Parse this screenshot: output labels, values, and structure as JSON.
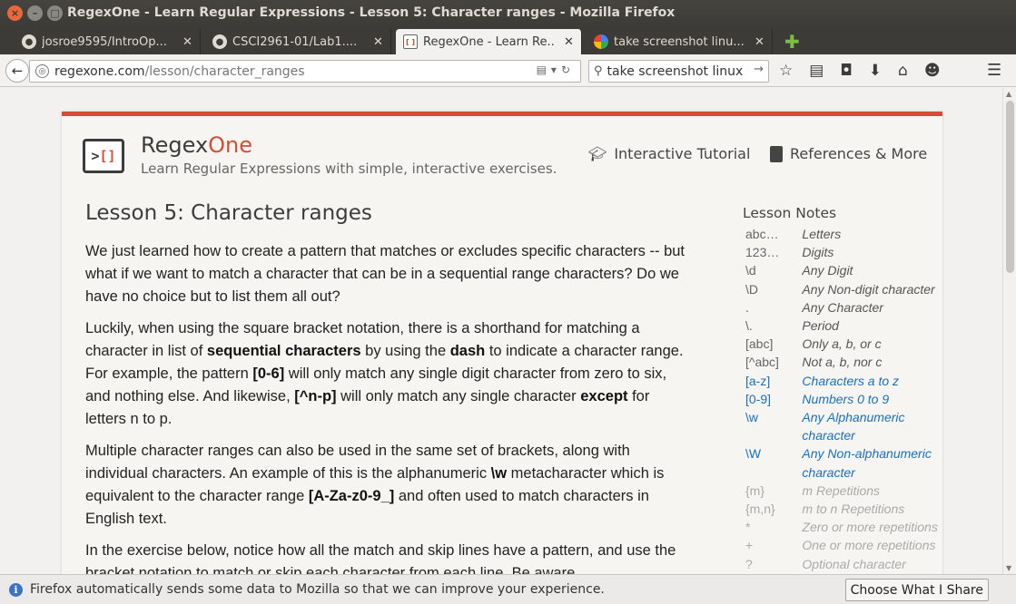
{
  "window": {
    "title": "RegexOne - Learn Regular Expressions - Lesson 5: Character ranges - Mozilla Firefox"
  },
  "tabs": [
    {
      "title": "josroe9595/IntroOp...",
      "icon": "github-icon"
    },
    {
      "title": "CSCI2961-01/Lab1....",
      "icon": "github-icon"
    },
    {
      "title": "RegexOne - Learn Re...",
      "icon": "regexone-icon"
    },
    {
      "title": "take screenshot linu...",
      "icon": "google-icon"
    }
  ],
  "nav": {
    "url_host": "regexone.com",
    "url_path": "/lesson/character_ranges",
    "search_value": "take screenshot linux"
  },
  "site": {
    "brand_main": "Regex",
    "brand_accent": "One",
    "tagline": "Learn Regular Expressions with simple, interactive exercises.",
    "nav_tutorial": "Interactive Tutorial",
    "nav_refs": "References & More",
    "accent_color": "#d64d34"
  },
  "lesson": {
    "title": "Lesson 5: Character ranges",
    "p1": "We just learned how to create a pattern that matches or excludes specific characters -- but what if we want to match a character that can be in a sequential range characters? Do we have no choice but to list them all out?",
    "p2": {
      "a": "Luckily, when using the square bracket notation, there is a shorthand for matching a character in list of ",
      "b": "sequential characters",
      "c": " by using the ",
      "d": "dash",
      "e": " to indicate a character range. For example, the pattern ",
      "f": "[0-6]",
      "g": " will only match any single digit character from zero to six, and nothing else. And likewise, ",
      "h": "[^n-p]",
      "i": " will only match any single character ",
      "j": "except",
      "k": " for letters n to p."
    },
    "p3": {
      "a": "Multiple character ranges can also be used in the same set of brackets, along with individual characters. An example of this is the alphanumeric ",
      "b": "\\w",
      "c": " metacharacter which is equivalent to the character range ",
      "d": "[A-Za-z0-9_]",
      "e": " and often used to match characters in English text."
    },
    "p4": "In the exercise below, notice how all the match and skip lines have a pattern, and use the bracket notation to match or skip each character from each line. Be aware"
  },
  "notes": {
    "title": "Lesson Notes",
    "items": [
      {
        "code": "abc…",
        "desc": "Letters",
        "state": "normal"
      },
      {
        "code": "123…",
        "desc": "Digits",
        "state": "normal"
      },
      {
        "code": "\\d",
        "desc": "Any Digit",
        "state": "normal"
      },
      {
        "code": "\\D",
        "desc": "Any Non-digit character",
        "state": "normal"
      },
      {
        "code": ".",
        "desc": "Any Character",
        "state": "normal"
      },
      {
        "code": "\\.",
        "desc": "Period",
        "state": "normal"
      },
      {
        "code": "[abc]",
        "desc": "Only a, b, or c",
        "state": "normal"
      },
      {
        "code": "[^abc]",
        "desc": "Not a, b, nor c",
        "state": "normal"
      },
      {
        "code": "[a-z]",
        "desc": "Characters a to z",
        "state": "highlight"
      },
      {
        "code": "[0-9]",
        "desc": "Numbers 0 to 9",
        "state": "highlight"
      },
      {
        "code": "\\w",
        "desc": "Any Alphanumeric character",
        "state": "highlight"
      },
      {
        "code": "\\W",
        "desc": "Any Non-alphanumeric character",
        "state": "highlight"
      },
      {
        "code": "{m}",
        "desc": "m Repetitions",
        "state": "dim"
      },
      {
        "code": "{m,n}",
        "desc": "m to n Repetitions",
        "state": "dim"
      },
      {
        "code": "*",
        "desc": "Zero or more repetitions",
        "state": "dim"
      },
      {
        "code": "+",
        "desc": "One or more repetitions",
        "state": "dim"
      },
      {
        "code": "?",
        "desc": "Optional character",
        "state": "dim"
      }
    ]
  },
  "notification": {
    "text": "Firefox automatically sends some data to Mozilla so that we can improve your experience.",
    "button": "Choose What I Share"
  }
}
